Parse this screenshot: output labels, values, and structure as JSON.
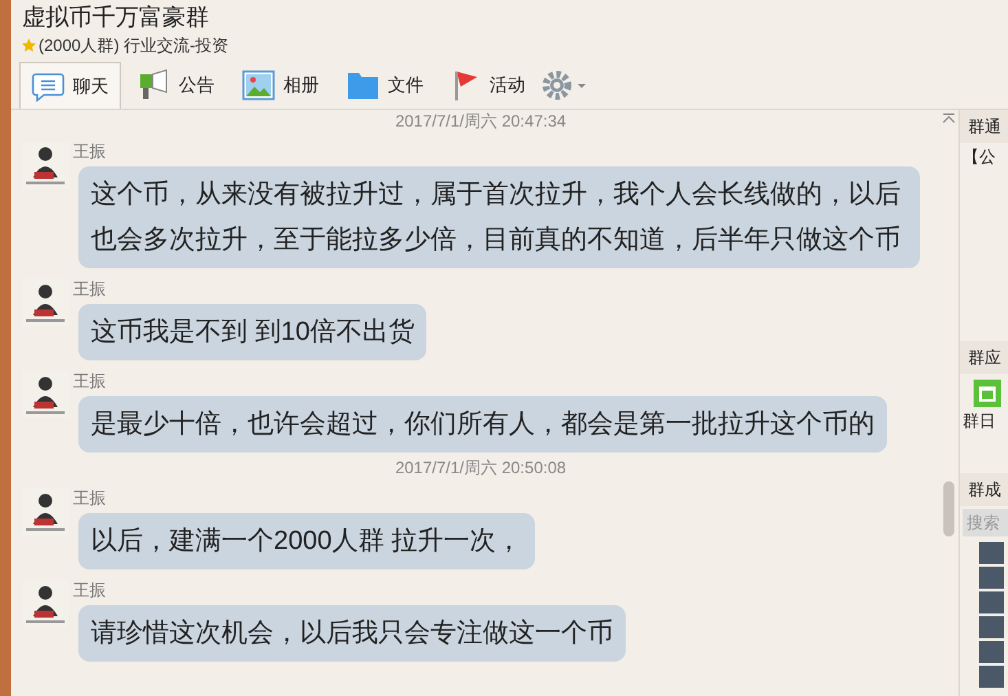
{
  "window": {
    "title": "虚拟币千万富豪群",
    "subtitle": "(2000人群) 行业交流-投资"
  },
  "toolbar": [
    {
      "kind": "chat",
      "label": "聊天",
      "selected": true
    },
    {
      "kind": "notice",
      "label": "公告",
      "selected": false
    },
    {
      "kind": "album",
      "label": "相册",
      "selected": false
    },
    {
      "kind": "file",
      "label": "文件",
      "selected": false
    },
    {
      "kind": "event",
      "label": "活动",
      "selected": false
    }
  ],
  "messages": [
    {
      "kind": "time",
      "text": "2017/7/1/周六 20:47:34"
    },
    {
      "kind": "msg",
      "sender": "王振",
      "text": "这个币，从来没有被拉升过，属于首次拉升，我个人会长线做的，以后也会多次拉升，至于能拉多少倍，目前真的不知道，后半年只做这个币"
    },
    {
      "kind": "msg",
      "sender": "王振",
      "text": "这币我是不到 到10倍不出货"
    },
    {
      "kind": "msg",
      "sender": "王振",
      "text": "是最少十倍，也许会超过，你们所有人，都会是第一批拉升这个币的"
    },
    {
      "kind": "time",
      "text": "2017/7/1/周六 20:50:08"
    },
    {
      "kind": "msg",
      "sender": "王振",
      "text": "以后，建满一个2000人群 拉升一次，"
    },
    {
      "kind": "msg",
      "sender": "王振",
      "text": "请珍惜这次机会，以后我只会专注做这一个币"
    }
  ],
  "side_panel": {
    "notice_title": "群通",
    "notice_text": "【公",
    "apps_title": "群应",
    "calendar_label": "群日",
    "members_title": "群成",
    "search": {
      "placeholder": "搜索"
    }
  }
}
